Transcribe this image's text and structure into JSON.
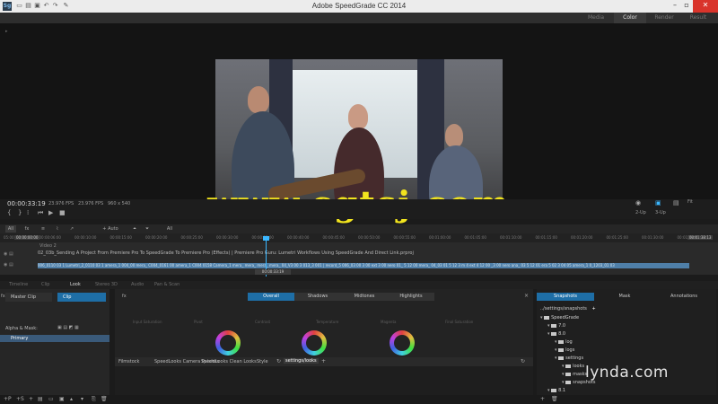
{
  "window": {
    "title": "Adobe SpeedGrade CC 2014",
    "app_icon": "Sg"
  },
  "mode_tabs": [
    {
      "label": "Media"
    },
    {
      "label": "Color",
      "active": true
    },
    {
      "label": "Render"
    },
    {
      "label": "Result"
    }
  ],
  "viewer": {
    "timecode": "00:00:33:19",
    "fps_a": "23.976 FPS",
    "fps_b": "23.976 FPS",
    "resolution": "960 x 540",
    "layout_2up": "2-Up",
    "layout_3up": "3-Up",
    "zoom": "Fit"
  },
  "watermark": "www.cgtsj.com",
  "track_toolbar": {
    "all": "All",
    "auto": "+ Auto",
    "all2": "All"
  },
  "ruler_ticks": [
    "05:00",
    "00:00:06:00",
    "00:00:10:00",
    "00:00:15:00",
    "00:00:20:00",
    "00:00:25:00",
    "00:00:30:00",
    "00:00:35:00",
    "00:00:40:00",
    "00:00:45:00",
    "00:00:50:00",
    "00:00:55:00",
    "00:01:00:00",
    "00:01:05:00",
    "00:01:10:00",
    "00:01:15:00",
    "00:01:20:00",
    "00:01:25:00",
    "00:01:30:00",
    "00:01:35:00"
  ],
  "ruler_start": "00:00:00:00",
  "ruler_end": "00:01:38:13",
  "tracks": {
    "video2": "Video 2",
    "clip_title": "02_03b_Sending A Project From Premiere Pro To SpeedGrade To Premiere Pro (Effects) | Premiere Pro Guru: Lumetri Workflows Using SpeedGrade And Direct Link.prproj",
    "clip_strip": "006_0110 03 1 Lumetri_2_0110 03 1 amera_1 004_00 mera_ C004_0161 00 amera_1 C004 0158 Camera_1 mera_ mera_ mera_ mera_ 04_V3 00 3 013_3 001 | record_5 006_03 00 3 00 ext 3 00 nero 01_ 5 12 00 mera_ 04_03 01 5 12 3 m 4 ext 4 12 00 _3 00 nero ana_ 03 5 12 01 era 5 02 3 04 05 amera_1 0_1203_01 03",
    "bottom_tc": "00:00:33:19"
  },
  "lower_tabs": [
    "Timeline",
    "Clip",
    "Look",
    "Stereo 3D",
    "Audio",
    "Pan & Scan"
  ],
  "layers": {
    "master_clip": "Master Clip",
    "clip": "Clip",
    "alpha_mask": "Alpha & Mask:",
    "primary": "Primary"
  },
  "grading": {
    "fx_label": "fx",
    "tabs": [
      {
        "label": "Overall",
        "active": true
      },
      {
        "label": "Shadows"
      },
      {
        "label": "Midtones"
      },
      {
        "label": "Highlights"
      }
    ],
    "sliders": [
      "Input Saturation",
      "Pivot",
      "Contrast",
      "Temperature",
      "Magenta",
      "Final Saturation"
    ]
  },
  "library_tabs": [
    "Filmstock",
    "SpeedLooks Camera Patches",
    "SpeedLooks Clean Looks",
    "Style",
    "settings/looks"
  ],
  "snapshots": {
    "tabs": [
      "Snapshots",
      "Mask",
      "Annotations"
    ],
    "path": "../settings/snapshots",
    "tree": [
      {
        "label": "SpeedGrade",
        "depth": 0
      },
      {
        "label": "7.0",
        "depth": 1
      },
      {
        "label": "8.0",
        "depth": 1
      },
      {
        "label": "log",
        "depth": 2
      },
      {
        "label": "logs",
        "depth": 2
      },
      {
        "label": "settings",
        "depth": 2
      },
      {
        "label": "looks",
        "depth": 3
      },
      {
        "label": "masks",
        "depth": 3
      },
      {
        "label": "snapshots",
        "depth": 3
      },
      {
        "label": "8.1",
        "depth": 1
      }
    ]
  },
  "branding": "lynda.com",
  "colors": {
    "accent": "#1e6ea6",
    "playhead": "#3ab7ff",
    "close": "#d9342b",
    "watermark": "#f2e41e"
  }
}
